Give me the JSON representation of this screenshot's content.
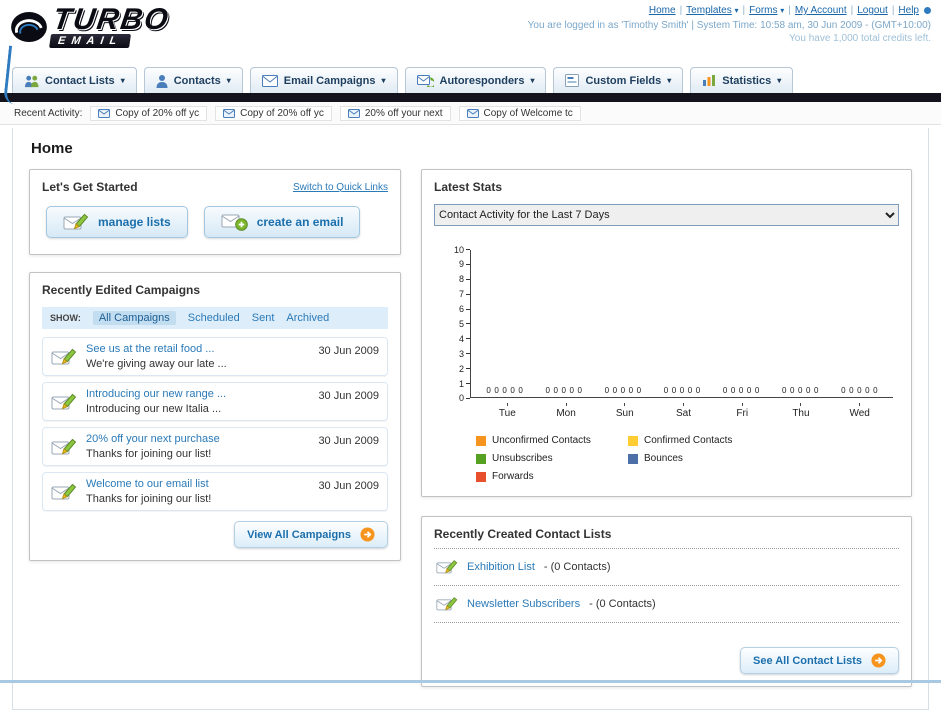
{
  "misc": {
    "pipe": "|"
  },
  "icons": {
    "chevron_down": "▾"
  },
  "header": {
    "logo_main": "TURBO",
    "logo_sub": "EMAIL",
    "top_links": [
      "Home",
      "Templates",
      "Forms",
      "My Account",
      "Logout",
      "Help"
    ],
    "login_info": "You are logged in as 'Timothy Smith' | System Time: 10:58 am, 30 Jun 2009 - (GMT+10:00)",
    "credits_info": "You have 1,000 total credits left."
  },
  "nav": {
    "tabs": [
      {
        "label": "Contact Lists"
      },
      {
        "label": "Contacts"
      },
      {
        "label": "Email Campaigns"
      },
      {
        "label": "Autoresponders"
      },
      {
        "label": "Custom Fields"
      },
      {
        "label": "Statistics"
      }
    ]
  },
  "recent_activity": {
    "label": "Recent Activity:",
    "items": [
      "Copy of 20% off yc",
      "Copy of 20% off yc",
      "20% off your next",
      "Copy of Welcome tc"
    ]
  },
  "page": {
    "title": "Home"
  },
  "get_started": {
    "title": "Let's Get Started",
    "switch_link": "Switch to Quick Links",
    "manage_lists_label": "manage lists",
    "create_email_label": "create an email"
  },
  "campaigns": {
    "title": "Recently Edited Campaigns",
    "show_label": "SHOW:",
    "filters": [
      "All Campaigns",
      "Scheduled",
      "Sent",
      "Archived"
    ],
    "items": [
      {
        "title": "See us at the retail food ...",
        "subtitle": "We're giving away our late ...",
        "date": "30 Jun 2009"
      },
      {
        "title": "Introducing our new range ...",
        "subtitle": "Introducing our new Italia ...",
        "date": "30 Jun 2009"
      },
      {
        "title": "20% off your next purchase",
        "subtitle": "Thanks for joining our list!",
        "date": "30 Jun 2009"
      },
      {
        "title": "Welcome to our email list",
        "subtitle": "Thanks for joining our list!",
        "date": "30 Jun 2009"
      }
    ],
    "view_all_label": "View All Campaigns"
  },
  "stats": {
    "title": "Latest Stats",
    "dropdown_value": "Contact Activity for the Last 7 Days",
    "chart_data": {
      "type": "bar",
      "title": "Contact Activity for the Last 7 Days",
      "categories": [
        "Tue",
        "Mon",
        "Sun",
        "Sat",
        "Fri",
        "Thu",
        "Wed"
      ],
      "series": [
        {
          "name": "Unconfirmed Contacts",
          "color": "#F7941E",
          "values": [
            0,
            0,
            0,
            0,
            0,
            0,
            0
          ]
        },
        {
          "name": "Confirmed Contacts",
          "color": "#FFCC33",
          "values": [
            0,
            0,
            0,
            0,
            0,
            0,
            0
          ]
        },
        {
          "name": "Unsubscribes",
          "color": "#56A121",
          "values": [
            0,
            0,
            0,
            0,
            0,
            0,
            0
          ]
        },
        {
          "name": "Bounces",
          "color": "#4D6FA8",
          "values": [
            0,
            0,
            0,
            0,
            0,
            0,
            0
          ]
        },
        {
          "name": "Forwards",
          "color": "#E8502D",
          "values": [
            0,
            0,
            0,
            0,
            0,
            0,
            0
          ]
        }
      ],
      "ylim": [
        0,
        10
      ],
      "grid": false,
      "legend_position": "bottom"
    }
  },
  "contact_lists": {
    "title": "Recently Created Contact Lists",
    "items": [
      {
        "name": "Exhibition List",
        "suffix": "- (0 Contacts)"
      },
      {
        "name": "Newsletter Subscribers",
        "suffix": "- (0 Contacts)"
      }
    ],
    "see_all_label": "See All Contact Lists"
  }
}
